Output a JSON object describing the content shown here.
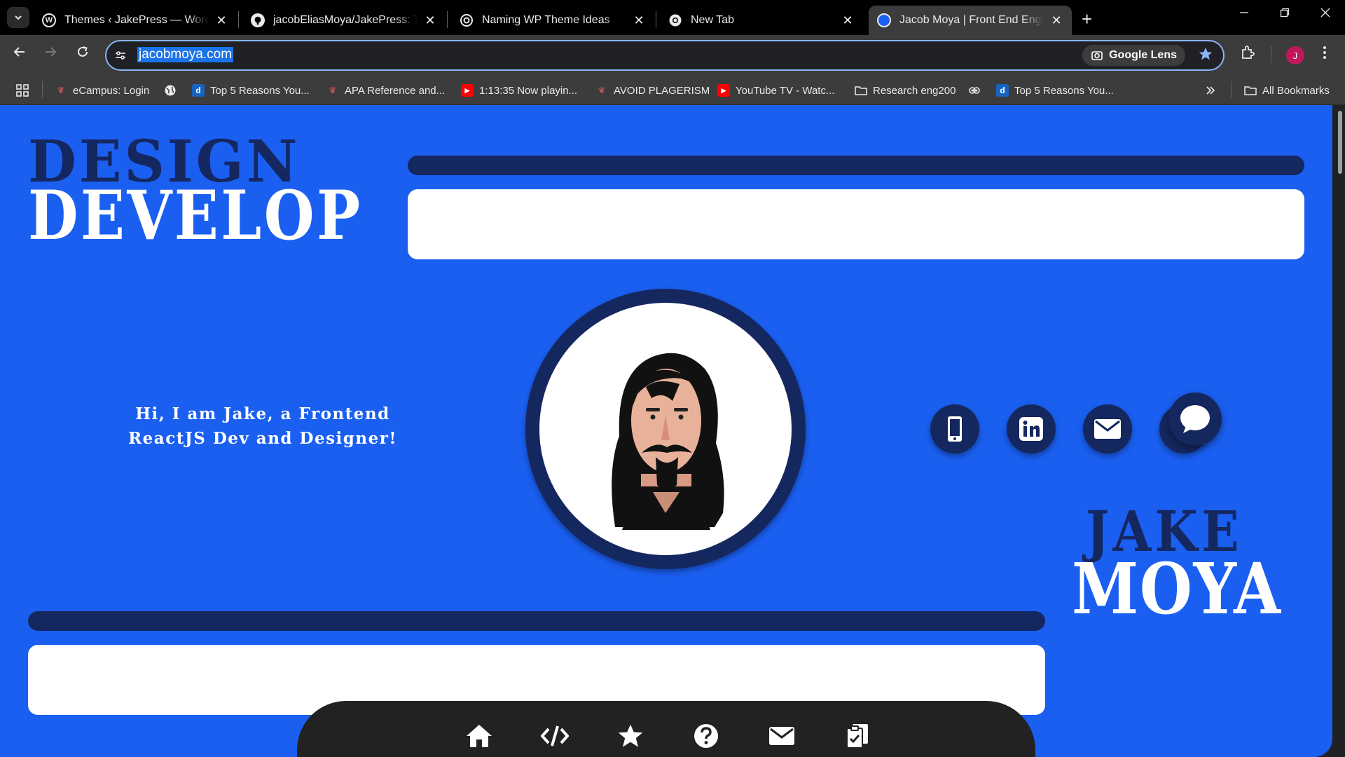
{
  "browser": {
    "tabs": [
      {
        "title": "Themes ‹ JakePress — WordPress",
        "icon": "wordpress-icon",
        "active": false
      },
      {
        "title": "jacobEliasMoya/JakePress: The theme",
        "icon": "github-icon",
        "active": false
      },
      {
        "title": "Naming WP Theme Ideas",
        "icon": "openai-icon",
        "active": false
      },
      {
        "title": "New Tab",
        "icon": "chrome-icon",
        "active": false
      },
      {
        "title": "Jacob Moya | Front End Engineer",
        "icon": "site-icon",
        "active": true
      }
    ],
    "close_glyph": "✕",
    "new_tab_glyph": "+",
    "url": "jacobmoya.com",
    "google_lens_label": "Google Lens",
    "profile_initial": "J",
    "bookmarks": [
      {
        "label": "eCampus: Login",
        "icon": "ecampus-icon",
        "color": "#b5525a"
      },
      {
        "label": "",
        "icon": "globe-icon",
        "color": "#e8eaed"
      },
      {
        "label": "Top 5 Reasons You...",
        "icon": "d-icon",
        "color": "#1565c0"
      },
      {
        "label": "APA Reference and...",
        "icon": "ecampus-icon",
        "color": "#b5525a"
      },
      {
        "label": "1:13:35 Now playin...",
        "icon": "youtube-icon",
        "color": "#ff0000"
      },
      {
        "label": "AVOID PLAGERISM",
        "icon": "ecampus-icon",
        "color": "#b5525a"
      },
      {
        "label": "YouTube TV - Watc...",
        "icon": "youtube-icon",
        "color": "#ff0000"
      },
      {
        "label": "Research eng200",
        "icon": "folder-icon",
        "color": "#e8eaed"
      },
      {
        "label": "",
        "icon": "owl-icon",
        "color": "#e8eaed"
      },
      {
        "label": "Top 5 Reasons You...",
        "icon": "d-icon",
        "color": "#1565c0"
      }
    ],
    "all_bookmarks_label": "All Bookmarks"
  },
  "page": {
    "headline_top": "DESIGN",
    "headline_bottom": "DEVELOP",
    "intro_text": "Hi, I am Jake, a Frontend ReactJS Dev and Designer!",
    "name_top": "JAKE",
    "name_bottom": "MOYA",
    "social": [
      "phone-icon",
      "linkedin-icon",
      "email-icon",
      "github-icon"
    ],
    "dock": [
      "home-icon",
      "code-icon",
      "star-icon",
      "question-icon",
      "mail-icon",
      "clipboard-check-icon"
    ]
  },
  "colors": {
    "background": "#1a5ff0",
    "navy": "#15275f",
    "white": "#ffffff",
    "dock": "#222222"
  }
}
